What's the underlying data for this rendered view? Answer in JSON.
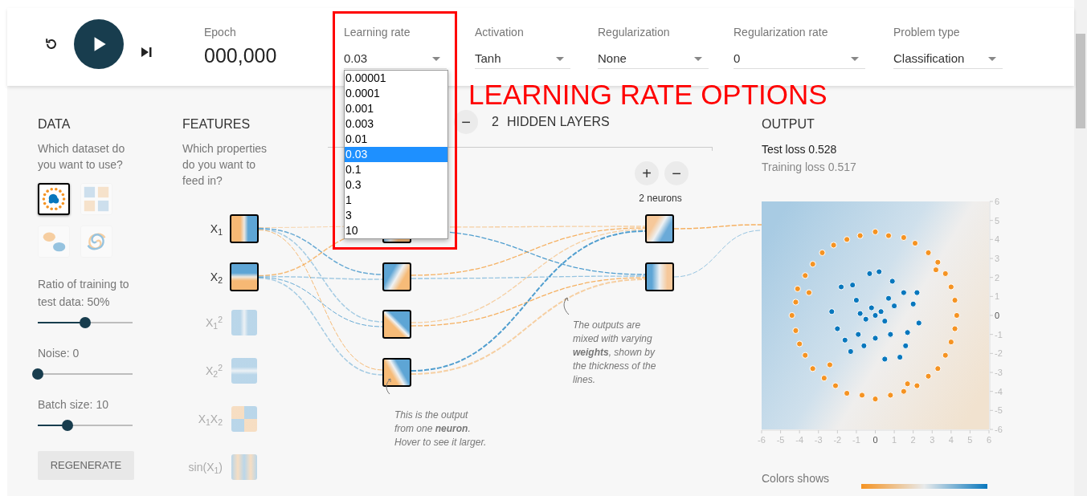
{
  "epoch": {
    "label": "Epoch",
    "value": "000,000"
  },
  "settings": [
    {
      "label": "Learning rate",
      "value": "0.03",
      "options": [
        {
          "label": "0.00001",
          "selected": false
        },
        {
          "label": "0.0001",
          "selected": false
        },
        {
          "label": "0.001",
          "selected": false
        },
        {
          "label": "0.003",
          "selected": false
        },
        {
          "label": "0.01",
          "selected": false
        },
        {
          "label": "0.03",
          "selected": true
        },
        {
          "label": "0.1",
          "selected": false
        },
        {
          "label": "0.3",
          "selected": false
        },
        {
          "label": "1",
          "selected": false
        },
        {
          "label": "3",
          "selected": false
        },
        {
          "label": "10",
          "selected": false
        }
      ]
    },
    {
      "label": "Activation",
      "value": "Tanh"
    },
    {
      "label": "Regularization",
      "value": "None"
    },
    {
      "label": "Regularization rate",
      "value": "0"
    },
    {
      "label": "Problem type",
      "value": "Classification"
    }
  ],
  "data": {
    "title": "DATA",
    "description": "Which dataset do you want to use?",
    "datasets": [
      {
        "kind": "circle",
        "selected": true
      },
      {
        "kind": "xor",
        "selected": false
      },
      {
        "kind": "gauss",
        "selected": false
      },
      {
        "kind": "spiral",
        "selected": false
      }
    ],
    "sliders": [
      {
        "label": "Ratio of training to test data:",
        "reading": "50%",
        "level": 0.5
      },
      {
        "label": "Noise:",
        "reading": "0",
        "level": 0
      },
      {
        "label": "Batch size:",
        "reading": "10",
        "level": 0.31
      }
    ],
    "regenerate": "REGENERATE"
  },
  "features": {
    "title": "FEATURES",
    "description": "Which properties do you want to feed in?",
    "items": [
      {
        "label": "X$_{1}$",
        "on": true
      },
      {
        "label": "X$_{2}$",
        "on": true
      },
      {
        "label": "X$_{1}$$^{2}$",
        "on": false
      },
      {
        "label": "X$_{2}$$^{2}$",
        "on": false
      },
      {
        "label": "X$_{1}$X$_{2}$",
        "on": false
      },
      {
        "label": "sin(X$_{1}$)",
        "on": false
      }
    ]
  },
  "hidden_layers": {
    "remove_button": "−",
    "count": "2",
    "title": "HIDDEN LAYERS",
    "layer_2": {
      "add_button": "+",
      "remove_button": "−",
      "neurons": "2 neurons"
    }
  },
  "notes": [
    "This is the output from one **neuron**. Hover to see it larger.",
    "The outputs are mixed with varying **weights**, shown by the thickness of the lines."
  ],
  "output": {
    "title": "OUTPUT",
    "test_loss": "Test loss 0.528",
    "training_loss": "Training loss 0.517",
    "chart_data": {
      "type": "scatter",
      "xlim": [
        -6,
        6
      ],
      "ylim": [
        -6,
        6
      ],
      "xticks": [
        -6,
        -5,
        -4,
        -3,
        -2,
        -1,
        0,
        1,
        2,
        3,
        4,
        5,
        6
      ],
      "yticks": [
        -6,
        -5,
        -4,
        -3,
        -2,
        -1,
        0,
        1,
        2,
        3,
        4,
        5,
        6
      ],
      "series": [
        {
          "color": "#f59322",
          "x": [
            4.3,
            4.2,
            4,
            3.7,
            3.3,
            2.8,
            2.1,
            1.5,
            0.7,
            0,
            -0.8,
            -1.5,
            -2.2,
            -2.8,
            -3.3,
            -3.7,
            -4.1,
            -4.2,
            -4.4,
            -4.2,
            -4,
            -3.7,
            -3.3,
            -2.7,
            -2.1,
            -1.5,
            -0.7,
            0,
            0.8,
            1.5,
            2.2,
            2.8,
            3.3,
            3.7,
            4,
            4.2,
            3.2,
            -3.5,
            1.7,
            -2.4
          ],
          "values": [
            0,
            0.8,
            1.5,
            2.2,
            2.8,
            3.3,
            3.8,
            4.1,
            4.2,
            4.4,
            4.2,
            4,
            3.7,
            3.3,
            2.7,
            2.1,
            1.4,
            0.7,
            0,
            -0.8,
            -1.5,
            -2.1,
            -2.8,
            -3.3,
            -3.7,
            -4.1,
            -4.2,
            -4.4,
            -4.2,
            -4,
            -3.7,
            -3.2,
            -2.8,
            -2.1,
            -1.4,
            -0.7,
            2.4,
            1.2,
            -3.6,
            -2.6
          ]
        },
        {
          "color": "#0877bd",
          "x": [
            0,
            0.3,
            -0.2,
            0.5,
            -0.5,
            1,
            -1,
            0.8,
            -0.9,
            1.5,
            -1.8,
            1.7,
            -1.6,
            0.2,
            -0.3,
            2.2,
            -2.3,
            0.5,
            -1.3,
            1.3,
            2,
            -1.2,
            0.9,
            -0.6,
            1.6,
            0,
            -2,
            2.3,
            0.7,
            -0.8
          ],
          "values": [
            0,
            0.2,
            0.4,
            -0.3,
            -0.2,
            0.5,
            0.8,
            -1,
            -1,
            1.2,
            1.5,
            -0.9,
            -1.3,
            2.3,
            2.2,
            1.2,
            0.2,
            -2.3,
            -1.9,
            -2.2,
            0.6,
            1.6,
            1.8,
            -1.6,
            -1.6,
            -1.2,
            -0.7,
            -0.4,
            0.9,
            0.1
          ]
        }
      ]
    },
    "legend": "Colors shows"
  },
  "annotation": {
    "text": "LEARNING RATE OPTIONS"
  }
}
